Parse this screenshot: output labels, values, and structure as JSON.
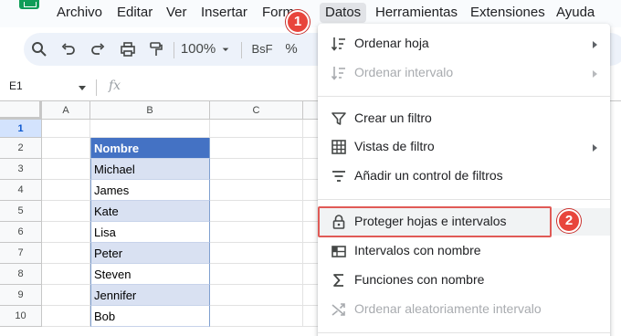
{
  "menubar": {
    "items": [
      "Archivo",
      "Editar",
      "Ver",
      "Insertar",
      "Form",
      "Datos",
      "Herramientas",
      "Extensiones",
      "Ayuda"
    ],
    "active": "Datos"
  },
  "toolbar": {
    "zoom": "100%",
    "font_format": "BsF",
    "percent": "%",
    "icons": [
      "search-icon",
      "undo-icon",
      "redo-icon",
      "print-icon",
      "paint-format-icon",
      "chevron-down-icon"
    ]
  },
  "formula_bar": {
    "name_box": "E1",
    "fx_label": "fx"
  },
  "grid": {
    "columns": [
      "A",
      "B",
      "C"
    ],
    "rows": [
      "1",
      "2",
      "3",
      "4",
      "5",
      "6",
      "7",
      "8",
      "9",
      "10"
    ],
    "table_header": "Nombre",
    "names": [
      "Michael",
      "James",
      "Kate",
      "Lisa",
      "Peter",
      "Steven",
      "Jennifer",
      "Bob"
    ],
    "colors": {
      "header": "#4472c4",
      "band": "#d9e1f2"
    }
  },
  "dropdown": {
    "items": [
      {
        "label": "Ordenar hoja",
        "icon": "sort-icon",
        "disabled": false,
        "submenu": true
      },
      {
        "label": "Ordenar intervalo",
        "icon": "sort-range-icon",
        "disabled": true,
        "submenu": true
      },
      {
        "label": "Crear un filtro",
        "icon": "filter-icon",
        "disabled": false,
        "submenu": false
      },
      {
        "label": "Vistas de filtro",
        "icon": "filter-views-icon",
        "disabled": false,
        "submenu": true
      },
      {
        "label": "Añadir un control de filtros",
        "icon": "slicer-icon",
        "disabled": false,
        "submenu": false
      },
      {
        "label": "Proteger hojas e intervalos",
        "icon": "lock-icon",
        "disabled": false,
        "submenu": false
      },
      {
        "label": "Intervalos con nombre",
        "icon": "named-ranges-icon",
        "disabled": false,
        "submenu": false
      },
      {
        "label": "Funciones con nombre",
        "icon": "sigma-icon",
        "disabled": false,
        "submenu": false
      },
      {
        "label": "Ordenar aleatoriamente intervalo",
        "icon": "shuffle-icon",
        "disabled": true,
        "submenu": false
      }
    ]
  },
  "callouts": {
    "first": "1",
    "second": "2",
    "color": "#e8453c"
  }
}
